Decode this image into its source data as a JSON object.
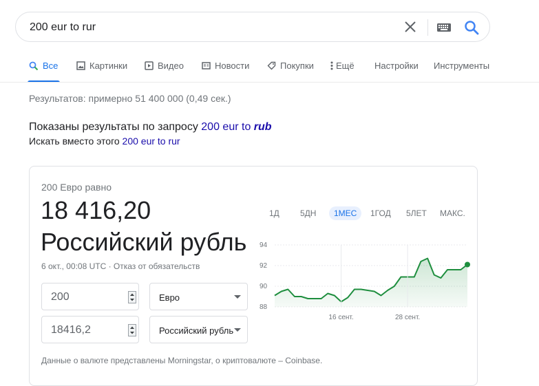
{
  "search": {
    "query": "200 eur to rur"
  },
  "tabs": [
    {
      "label": "Все",
      "icon": "search-icon"
    },
    {
      "label": "Картинки",
      "icon": "image-icon"
    },
    {
      "label": "Видео",
      "icon": "video-icon"
    },
    {
      "label": "Новости",
      "icon": "news-icon"
    },
    {
      "label": "Покупки",
      "icon": "tag-icon"
    },
    {
      "label": "Ещё",
      "icon": "more-vert-icon"
    },
    {
      "label": "Настройки"
    },
    {
      "label": "Инструменты"
    }
  ],
  "stats": "Результатов: примерно 51 400 000 (0,49 сек.)",
  "spell": {
    "shown_prefix": "Показаны результаты по запросу ",
    "shown_query_plain": "200 eur to ",
    "shown_query_emph": "rub",
    "instead_prefix": "Искать вместо этого ",
    "instead_query": "200 eur to rur"
  },
  "converter": {
    "equal_label": "200 Евро равно",
    "result_amount": "18 416,20",
    "result_currency": "Российский рубль",
    "timestamp": "6 окт., 00:08 UTC · Отказ от обязательств",
    "from_value": "200",
    "from_currency": "Евро",
    "to_value": "18416,2",
    "to_currency": "Российский рубль",
    "source": "Данные о валюте представлены Morningstar, о криптовалюте – Coinbase."
  },
  "ranges": [
    "1Д",
    "5ДН",
    "1МЕС",
    "1ГОД",
    "5ЛЕТ",
    "МАКС."
  ],
  "active_range": "1МЕС",
  "colors": {
    "accent": "#1a73e8",
    "line": "#1e8e3e",
    "link": "#1a0dab"
  },
  "chart_data": {
    "type": "area",
    "y_ticks": [
      "94",
      "92",
      "90",
      "88"
    ],
    "ylim": [
      88,
      94
    ],
    "x_ticks": [
      {
        "label": "16 сент.",
        "index": 10
      },
      {
        "label": "28 сент.",
        "index": 20
      }
    ],
    "values": [
      89.1,
      89.5,
      89.7,
      89.0,
      89.0,
      88.8,
      88.8,
      88.8,
      89.3,
      89.1,
      88.5,
      88.9,
      89.7,
      89.7,
      89.6,
      89.5,
      89.1,
      89.6,
      90.0,
      90.9,
      90.9,
      90.9,
      92.4,
      92.7,
      91.1,
      90.8,
      91.6,
      91.6,
      91.6,
      92.1
    ]
  }
}
